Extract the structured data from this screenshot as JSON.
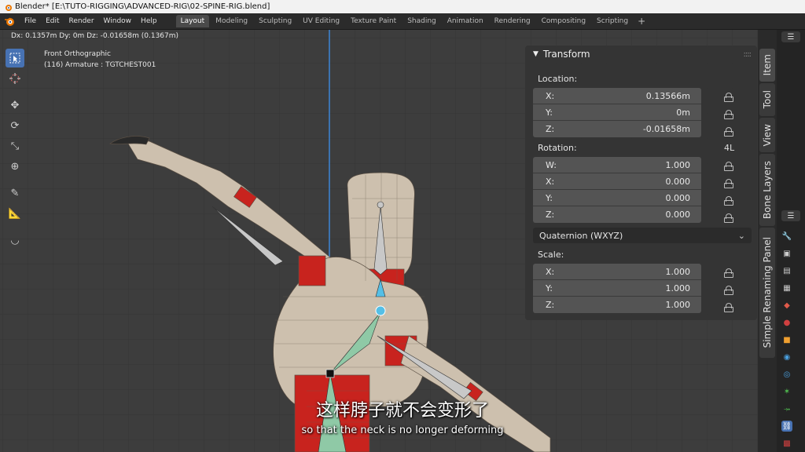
{
  "window": {
    "title": "Blender* [E:\\TUTO-RIGGING\\ADVANCED-RIG\\02-SPINE-RIG.blend]"
  },
  "menus": [
    "File",
    "Edit",
    "Render",
    "Window",
    "Help"
  ],
  "workspaces": [
    "Layout",
    "Modeling",
    "Sculpting",
    "UV Editing",
    "Texture Paint",
    "Shading",
    "Animation",
    "Rendering",
    "Compositing",
    "Scripting"
  ],
  "active_workspace": "Layout",
  "viewport": {
    "header_info": "Dx: 0.1357m  Dy: 0m  Dz: -0.01658m (0.1367m)",
    "view_name": "Front Orthographic",
    "object_info": "(116) Armature : TGTCHEST001"
  },
  "transform_panel": {
    "title": "Transform",
    "location": {
      "label": "Location:",
      "x": "0.13566m",
      "y": "0m",
      "z": "-0.01658m"
    },
    "rotation": {
      "label": "Rotation:",
      "mode_flag": "4L",
      "w": "1.000",
      "x": "0.000",
      "y": "0.000",
      "z": "0.000",
      "mode": "Quaternion (WXYZ)"
    },
    "scale": {
      "label": "Scale:",
      "x": "1.000",
      "y": "1.000",
      "z": "1.000"
    },
    "axis_labels": {
      "w": "W:",
      "x": "X:",
      "y": "Y:",
      "z": "Z:"
    }
  },
  "side_tabs": [
    "Item",
    "Tool",
    "View",
    "Bone Layers",
    "Simple Renaming Panel"
  ],
  "subtitles": {
    "zh": "这样脖子就不会变形了",
    "en": "so that the neck is no longer deforming"
  },
  "colors": {
    "accent": "#4772b3",
    "mesh": "#cdc0ae",
    "mesh_red": "#c8231e",
    "bone_blue": "#55bfe6",
    "bone_green": "#8fc9a6"
  }
}
